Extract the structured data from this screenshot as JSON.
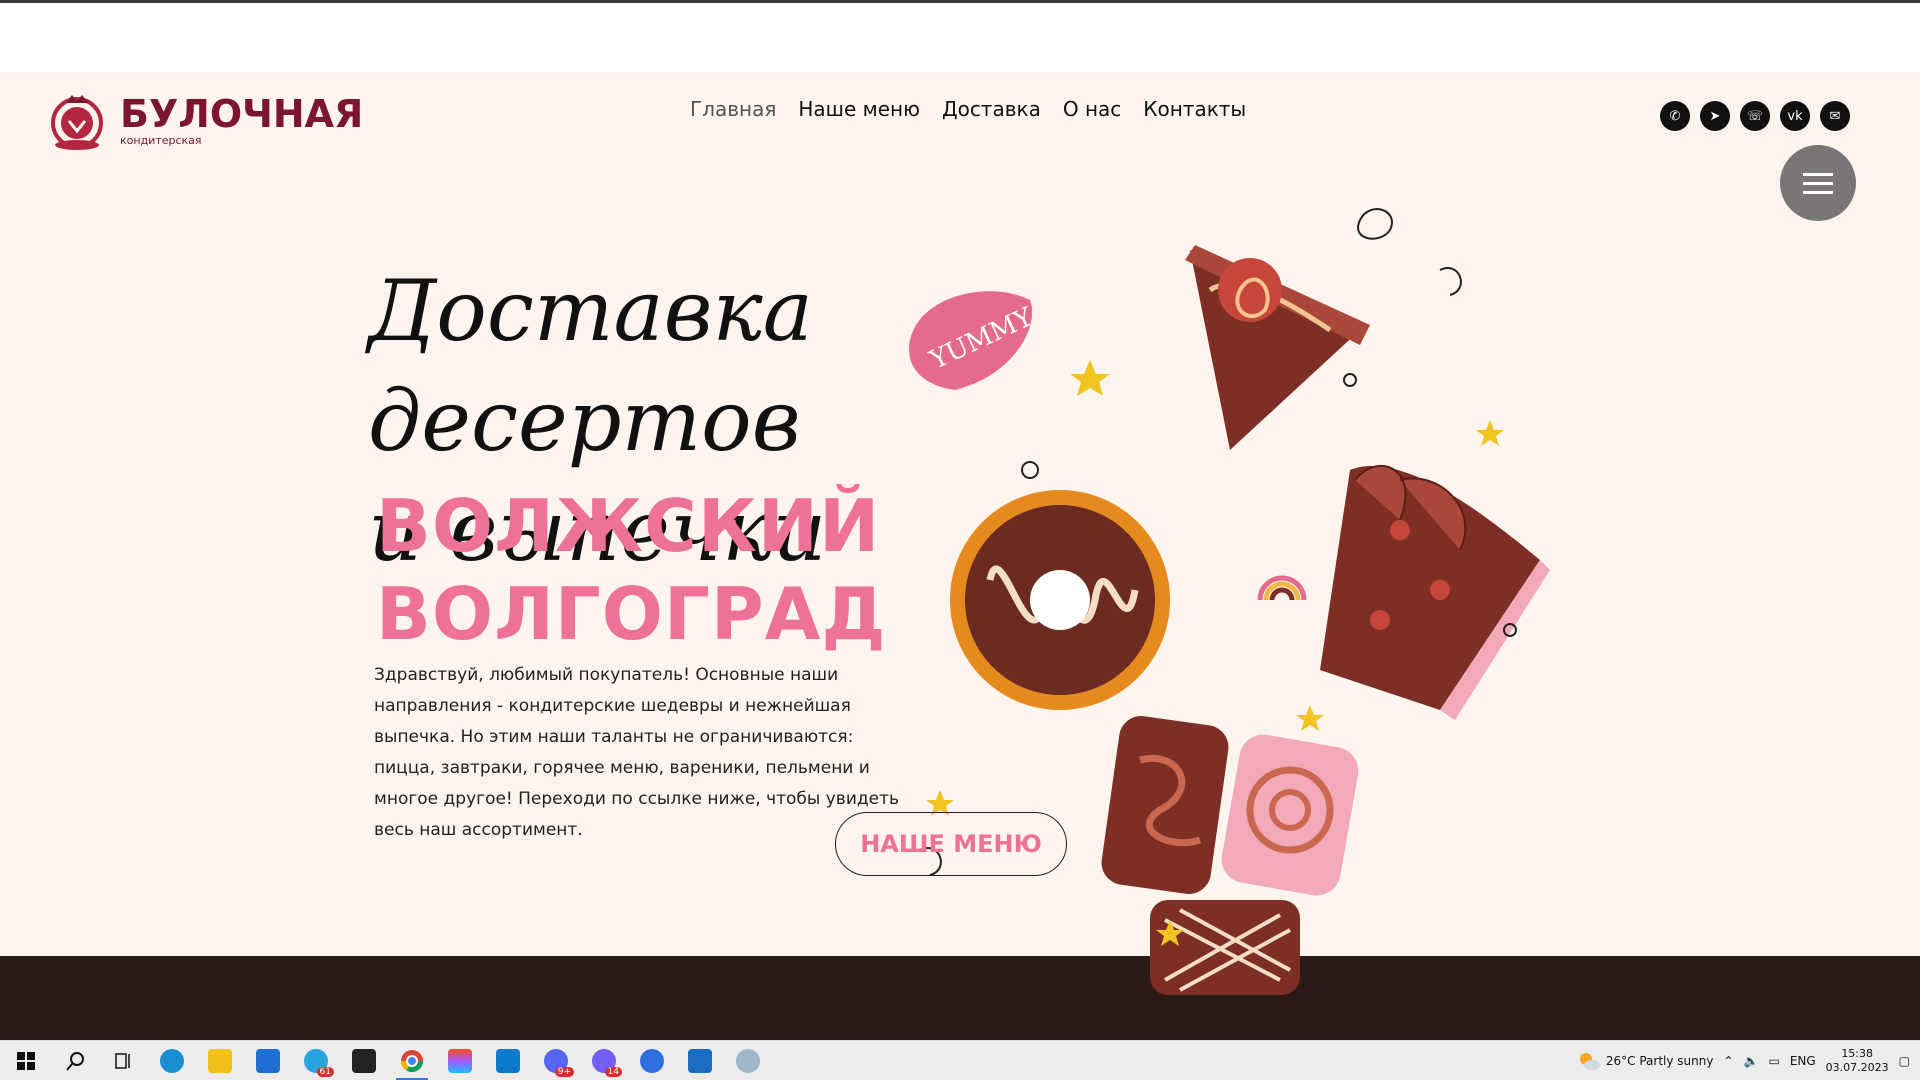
{
  "brand": {
    "title": "БУЛОЧНАЯ",
    "subtitle": "кондитерская"
  },
  "nav": {
    "items": [
      {
        "label": "Главная"
      },
      {
        "label": "Наше меню"
      },
      {
        "label": "Доставка"
      },
      {
        "label": "О нас"
      },
      {
        "label": "Контакты"
      }
    ]
  },
  "social": {
    "icons": [
      "phone-icon",
      "telegram-icon",
      "whatsapp-icon",
      "vk-icon",
      "email-icon"
    ]
  },
  "hero": {
    "headline_line1": "Доставка десертов",
    "headline_line2": "и выпечки",
    "city_line1": "ВОЛЖСКИЙ",
    "city_line2": "ВОЛГОГРАД",
    "intro": "Здравствуй, любимый покупатель! Основные наши направления - кондитерские шедевры и нежнейшая выпечка. Но этим наши таланты не ограничиваются: пицца, завтраки, горячее меню, вареники, пельмени и многое другое! Переходи по ссылке ниже, чтобы увидеть весь наш ассортимент.",
    "menu_button": "НАШЕ МЕНЮ",
    "yummy": "YUMMY"
  },
  "colors": {
    "bg": "#fdf4ee",
    "accent_pink": "#ee7197",
    "brand_burgundy": "#7b1530",
    "dark_footer": "#2b1a17"
  },
  "taskbar": {
    "weather": "26°C  Partly sunny",
    "lang": "ENG",
    "time": "15:38",
    "date": "03.07.2023",
    "badges": {
      "telegram": "61",
      "discord": "9+",
      "viber": "14"
    }
  }
}
